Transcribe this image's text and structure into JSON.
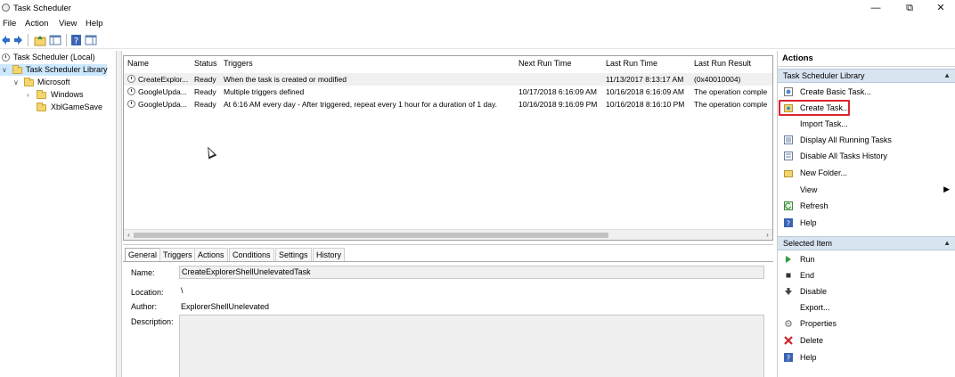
{
  "window": {
    "title": "Task Scheduler",
    "minimize": "—",
    "maximize": "⧉",
    "close": "✕"
  },
  "menu": [
    "File",
    "Action",
    "View",
    "Help"
  ],
  "tree": [
    {
      "label": "Task Scheduler (Local)"
    },
    {
      "label": "Task Scheduler Library"
    },
    {
      "label": "Microsoft"
    },
    {
      "label": "Windows"
    },
    {
      "label": "XblGameSave"
    }
  ],
  "task_list": {
    "columns": [
      "Name",
      "Status",
      "Triggers",
      "Next Run Time",
      "Last Run Time",
      "Last Run Result"
    ],
    "rows": [
      {
        "name": "CreateExplor...",
        "status": "Ready",
        "triggers": "When the task is created or modified",
        "next": "",
        "last": "11/13/2017 8:13:17 AM",
        "result": "(0x40010004)"
      },
      {
        "name": "GoogleUpda...",
        "status": "Ready",
        "triggers": "Multiple triggers defined",
        "next": "10/17/2018 6:16:09 AM",
        "last": "10/16/2018 6:16:09 AM",
        "result": "The operation comple"
      },
      {
        "name": "GoogleUpda...",
        "status": "Ready",
        "triggers": "At 6:16 AM every day - After triggered, repeat every 1 hour for a duration of 1 day.",
        "next": "10/16/2018 9:16:09 PM",
        "last": "10/16/2018 8:16:10 PM",
        "result": "The operation comple"
      }
    ]
  },
  "detail": {
    "tabs": [
      "General",
      "Triggers",
      "Actions",
      "Conditions",
      "Settings",
      "History"
    ],
    "name_label": "Name:",
    "name_value": "CreateExplorerShellUnelevatedTask",
    "location_label": "Location:",
    "location_value": "\\",
    "author_label": "Author:",
    "author_value": "ExplorerShellUnelevated",
    "description_label": "Description:"
  },
  "actions": {
    "title": "Actions",
    "library_section": "Task Scheduler Library",
    "library_items": [
      {
        "label": "Create Basic Task...",
        "icon": "create-basic-task-icon"
      },
      {
        "label": "Create Task...",
        "icon": "create-task-icon"
      },
      {
        "label": "Import Task...",
        "icon": "import-task-icon"
      },
      {
        "label": "Display All Running Tasks",
        "icon": "running-tasks-icon"
      },
      {
        "label": "Disable All Tasks History",
        "icon": "disable-history-icon"
      },
      {
        "label": "New Folder...",
        "icon": "folder-icon"
      },
      {
        "label": "View",
        "icon": "view-icon"
      },
      {
        "label": "Refresh",
        "icon": "refresh-icon"
      },
      {
        "label": "Help",
        "icon": "help-icon"
      }
    ],
    "selected_section": "Selected Item",
    "selected_items": [
      {
        "label": "Run",
        "icon": "run-icon"
      },
      {
        "label": "End",
        "icon": "end-icon"
      },
      {
        "label": "Disable",
        "icon": "disable-icon"
      },
      {
        "label": "Export...",
        "icon": "export-icon"
      },
      {
        "label": "Properties",
        "icon": "properties-icon"
      },
      {
        "label": "Delete",
        "icon": "delete-icon"
      },
      {
        "label": "Help",
        "icon": "help-icon"
      }
    ]
  },
  "colors": {
    "selection": "#cce8ff",
    "section": "#d9e4f1",
    "highlight": "#d9272e"
  }
}
